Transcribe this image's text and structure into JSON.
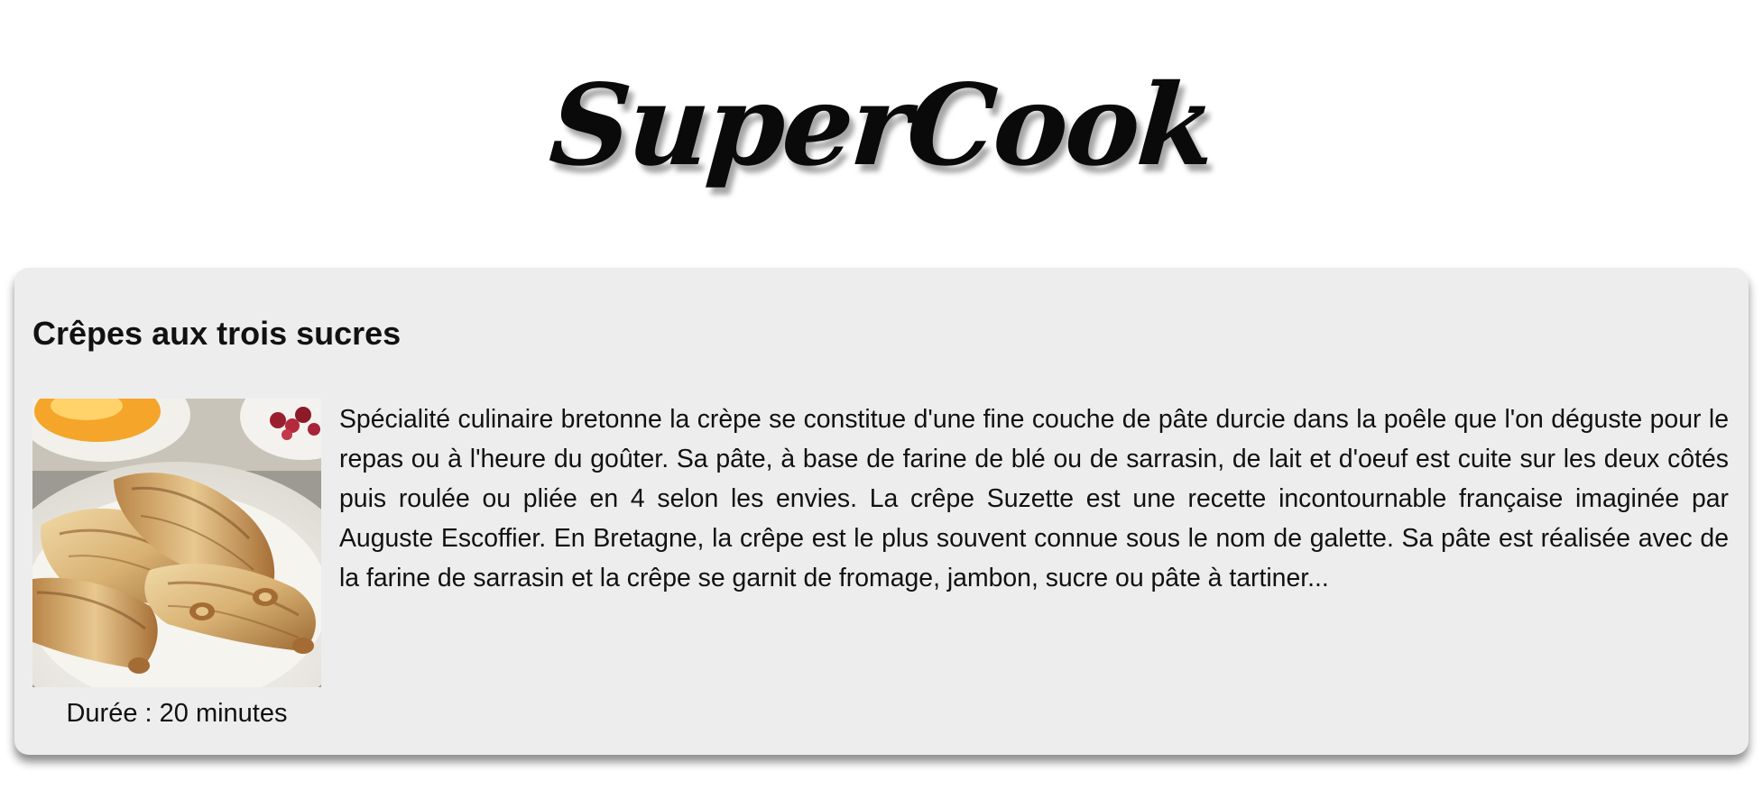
{
  "header": {
    "logo_text": "SuperCook"
  },
  "recipe": {
    "title": "Crêpes aux trois sucres",
    "image_icon": "crepes-photo",
    "description": "Spécialité culinaire bretonne la crèpe se constitue d'une fine couche de pâte durcie dans la poêle que l'on déguste pour le repas ou à l'heure du goûter. Sa pâte, à base de farine de blé ou de sarrasin, de lait et d'oeuf est cuite sur les deux côtés puis roulée ou pliée en 4 selon les envies. La crêpe Suzette est une recette incontournable française imaginée par Auguste Escoffier. En Bretagne, la crêpe est le plus souvent connue sous le nom de galette. Sa pâte est réalisée avec de la farine de sarrasin et la crêpe se garnit de fromage, jambon, sucre ou pâte à tartiner...",
    "duration": "Durée : 20 minutes"
  },
  "colors": {
    "page_background": "#ffffff",
    "card_background": "#ededed",
    "text": "#111111"
  }
}
